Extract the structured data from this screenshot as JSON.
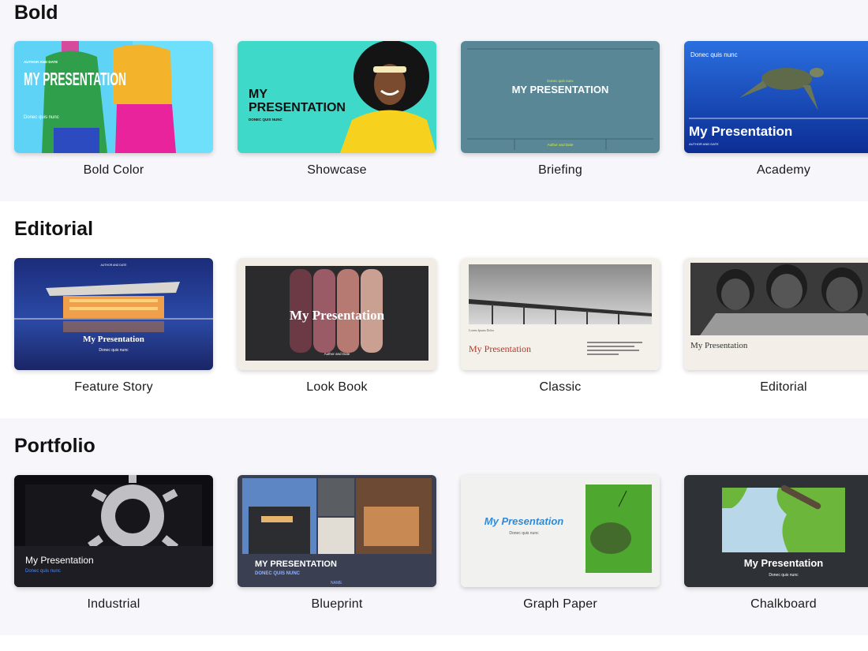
{
  "sections": [
    {
      "title": "Bold",
      "themes": [
        {
          "name": "Bold Color",
          "thumb_title": "MY PRESENTATION",
          "thumb_sub": "Donec quis nunc",
          "thumb_top": "AUTHOR AND DATE"
        },
        {
          "name": "Showcase",
          "thumb_title_1": "MY",
          "thumb_title_2": "PRESENTATION",
          "thumb_sub": "DONEC QUIS NUNC"
        },
        {
          "name": "Briefing",
          "thumb_title": "MY PRESENTATION",
          "thumb_sub": "Donec quis nunc",
          "thumb_footer": "Author and Date"
        },
        {
          "name": "Academy",
          "thumb_title": "My Presentation",
          "thumb_top": "Donec quis nunc",
          "thumb_sub": "AUTHOR AND DATE"
        }
      ]
    },
    {
      "title": "Editorial",
      "themes": [
        {
          "name": "Feature Story",
          "thumb_title": "My Presentation",
          "thumb_sub": "Donec quis nunc",
          "thumb_top": "AUTHOR AND DATE"
        },
        {
          "name": "Look Book",
          "thumb_title": "My Presentation",
          "thumb_sub": "Author and Date"
        },
        {
          "name": "Classic",
          "thumb_title": "My Presentation",
          "thumb_sub": "Lorem Ipsum Dolor"
        },
        {
          "name": "Editorial",
          "thumb_title": "My Presentation"
        }
      ]
    },
    {
      "title": "Portfolio",
      "themes": [
        {
          "name": "Industrial",
          "thumb_title": "My Presentation",
          "thumb_sub": "Donec quis nunc"
        },
        {
          "name": "Blueprint",
          "thumb_title": "MY PRESENTATION",
          "thumb_sub": "DONEC QUIS NUNC",
          "thumb_footer": "NAME"
        },
        {
          "name": "Graph Paper",
          "thumb_title": "My Presentation",
          "thumb_sub": "Donec quis nunc"
        },
        {
          "name": "Chalkboard",
          "thumb_title": "My Presentation",
          "thumb_sub": "Donec quis nunc"
        }
      ]
    }
  ],
  "colors": {
    "bold_color_bg": "#5fd3f5",
    "showcase_bg": "#3ed9c8",
    "briefing_bg": "#5a8796",
    "academy_bg": "#1b57c9",
    "feature_story_bg": "#23388a",
    "look_book_bg": "#2b2b2e",
    "classic_accent": "#b23a2a",
    "graph_paper_title": "#2f8bd6",
    "chalkboard_bg": "#2e3236"
  }
}
